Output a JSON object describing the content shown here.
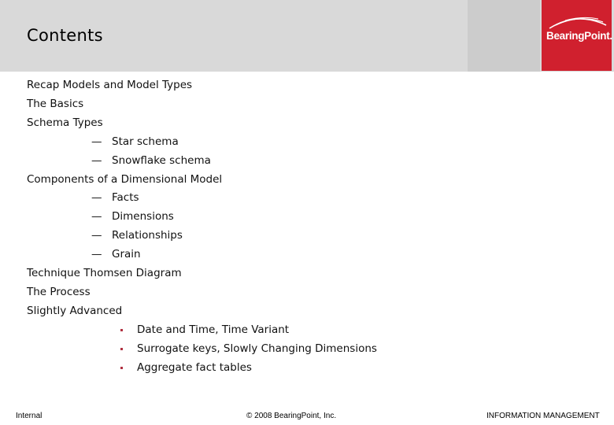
{
  "header": {
    "title": "Contents",
    "logo_text": "BearingPoint.",
    "colors": {
      "band": "#d9d9d9",
      "block": "#cccccc",
      "logo_bg": "#d0202e"
    }
  },
  "toc": [
    {
      "level": 0,
      "text": "Recap Models and Model Types"
    },
    {
      "level": 0,
      "text": "The Basics"
    },
    {
      "level": 0,
      "text": "Schema Types"
    },
    {
      "level": 1,
      "marker": "—",
      "text": "Star schema"
    },
    {
      "level": 1,
      "marker": "—",
      "text": "Snowflake schema"
    },
    {
      "level": 0,
      "text": "Components of a Dimensional Model"
    },
    {
      "level": 1,
      "marker": "—",
      "text": "Facts"
    },
    {
      "level": 1,
      "marker": "—",
      "text": "Dimensions"
    },
    {
      "level": 1,
      "marker": "—",
      "text": "Relationships"
    },
    {
      "level": 1,
      "marker": "—",
      "text": "Grain"
    },
    {
      "level": 0,
      "text": "Technique Thomsen Diagram"
    },
    {
      "level": 0,
      "text": "The Process"
    },
    {
      "level": 0,
      "text": "Slightly Advanced"
    },
    {
      "level": 2,
      "marker": "square-bullet",
      "text": "Date and Time, Time Variant"
    },
    {
      "level": 2,
      "marker": "square-bullet",
      "text": "Surrogate keys, Slowly Changing Dimensions"
    },
    {
      "level": 2,
      "marker": "square-bullet",
      "text": "Aggregate fact tables"
    }
  ],
  "footer": {
    "left": "Internal",
    "center": "© 2008 BearingPoint, Inc.",
    "right": "INFORMATION MANAGEMENT"
  }
}
